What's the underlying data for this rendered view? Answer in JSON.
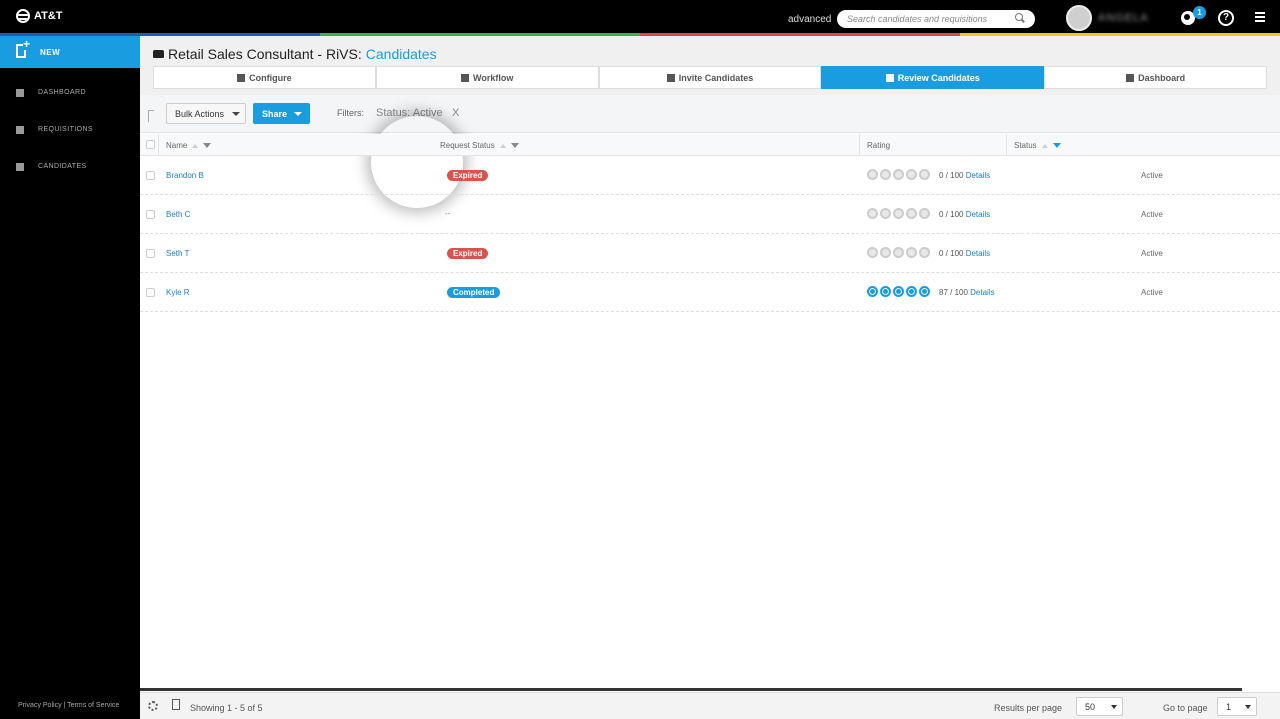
{
  "brand": {
    "logo_text": "AT&T"
  },
  "colors": {
    "accent": "#1a9de0",
    "expired": "#d9534f",
    "completed": "#1a9de0",
    "strip": [
      "#1a5fb4",
      "#3aae5f",
      "#e0464f",
      "#f5c518"
    ]
  },
  "header": {
    "mode": "advanced",
    "search_placeholder": "Search candidates and requisitions",
    "user_name": "ANGELA",
    "notifications_count": "1",
    "help_label": "?"
  },
  "sidebar": {
    "new_label": "NEW",
    "items": [
      {
        "label": "DASHBOARD",
        "icon": "bar-chart-icon"
      },
      {
        "label": "REQUISITIONS",
        "icon": "document-icon"
      },
      {
        "label": "CANDIDATES",
        "icon": "person-icon"
      }
    ],
    "footer": "Privacy Policy | Terms of Service"
  },
  "page": {
    "title_prefix": "Retail Sales Consultant - RiVS:",
    "title_accent": "Candidates"
  },
  "steps": [
    {
      "label": "Configure",
      "icon": "wrench-icon",
      "active": false
    },
    {
      "label": "Workflow",
      "icon": "branch-icon",
      "active": false
    },
    {
      "label": "Invite Candidates",
      "icon": "plus-icon",
      "active": false
    },
    {
      "label": "Review Candidates",
      "icon": "review-icon",
      "active": true
    },
    {
      "label": "Dashboard",
      "icon": "bar-chart-icon",
      "active": false
    }
  ],
  "toolbar": {
    "bulk_actions_label": "Bulk Actions",
    "share_label": "Share",
    "filters_label": "Filters:",
    "filter_chip": "Status: Active",
    "filter_remove": "X"
  },
  "table": {
    "columns": {
      "name": "Name",
      "request_status": "Request Status",
      "rating": "Rating",
      "status": "Status"
    },
    "rows": [
      {
        "name": "Brandon B",
        "request_status": "Expired",
        "rating": 0,
        "score": "0 / 100",
        "details": "Details",
        "status": "Active"
      },
      {
        "name": "Beth C",
        "request_status": "--",
        "rating": 0,
        "score": "0 / 100",
        "details": "Details",
        "status": "Active"
      },
      {
        "name": "Seth T",
        "request_status": "Expired",
        "rating": 0,
        "score": "0 / 100",
        "details": "Details",
        "status": "Active"
      },
      {
        "name": "Kyle R",
        "request_status": "Completed",
        "rating": 5,
        "score": "87 / 100",
        "details": "Details",
        "status": "Active"
      }
    ]
  },
  "footer": {
    "showing": "Showing 1 - 5 of 5",
    "results_per_page_label": "Results per page",
    "results_per_page_value": "50",
    "go_to_page_label": "Go to page",
    "go_to_page_value": "1"
  }
}
